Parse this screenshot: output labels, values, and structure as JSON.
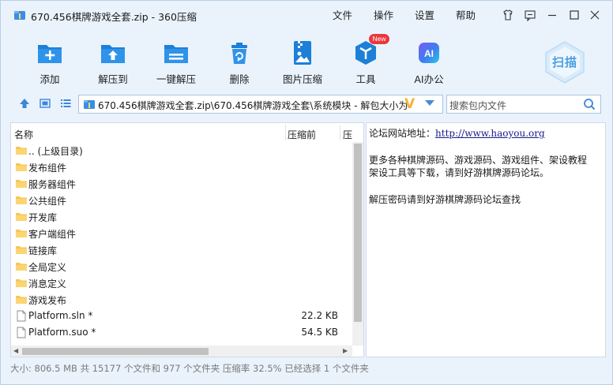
{
  "window": {
    "title": "670.456棋牌游戏全套.zip - 360压缩",
    "menu": [
      "文件",
      "操作",
      "设置",
      "帮助"
    ]
  },
  "toolbar": {
    "buttons": [
      {
        "label": "添加",
        "icon": "add-to-archive-icon"
      },
      {
        "label": "解压到",
        "icon": "extract-to-icon"
      },
      {
        "label": "一键解压",
        "icon": "one-click-extract-icon"
      },
      {
        "label": "删除",
        "icon": "trash-icon"
      },
      {
        "label": "图片压缩",
        "icon": "image-compress-icon"
      },
      {
        "label": "工具",
        "icon": "tools-icon"
      },
      {
        "label": "AI办公",
        "icon": "ai-office-icon"
      }
    ],
    "new_badge": "New",
    "ai_icon_text": "AI",
    "scan_label": "扫描"
  },
  "address": {
    "path": "670.456棋牌游戏全套.zip\\670.456棋牌游戏全套\\系统模块 - 解包大小为",
    "size_indicator": "V"
  },
  "search": {
    "placeholder": "搜索包内文件"
  },
  "columns": {
    "name": "名称",
    "size": "压缩前",
    "compressed": "压"
  },
  "files": [
    {
      "name": ".. (上级目录)",
      "size": "",
      "type": "folder"
    },
    {
      "name": "发布组件",
      "size": "",
      "type": "folder"
    },
    {
      "name": "服务器组件",
      "size": "",
      "type": "folder"
    },
    {
      "name": "公共组件",
      "size": "",
      "type": "folder"
    },
    {
      "name": "开发库",
      "size": "",
      "type": "folder"
    },
    {
      "name": "客户端组件",
      "size": "",
      "type": "folder"
    },
    {
      "name": "链接库",
      "size": "",
      "type": "folder"
    },
    {
      "name": "全局定义",
      "size": "",
      "type": "folder"
    },
    {
      "name": "消息定义",
      "size": "",
      "type": "folder"
    },
    {
      "name": "游戏发布",
      "size": "",
      "type": "folder"
    },
    {
      "name": "Platform.sln *",
      "size": "22.2 KB",
      "type": "file"
    },
    {
      "name": "Platform.suo *",
      "size": "54.5 KB",
      "type": "file"
    }
  ],
  "comment": {
    "line1_prefix": "论坛网站地址：",
    "line1_link": "http://www.haoyou.org",
    "line2": "更多各种棋牌源码、游戏源码、游戏组件、架设教程",
    "line3": "架设工具等下载，请到好游棋牌源码论坛。",
    "line4": "解压密码请到好游棋牌源码论坛查找"
  },
  "status": {
    "text": "大小: 806.5 MB 共 15177 个文件和 977 个文件夹 压缩率 32.5% 已经选择 1 个文件夹"
  },
  "colors": {
    "accent": "#2a8ee0",
    "folder": "#f6c75c",
    "window_bg": "#eaf3fc"
  }
}
